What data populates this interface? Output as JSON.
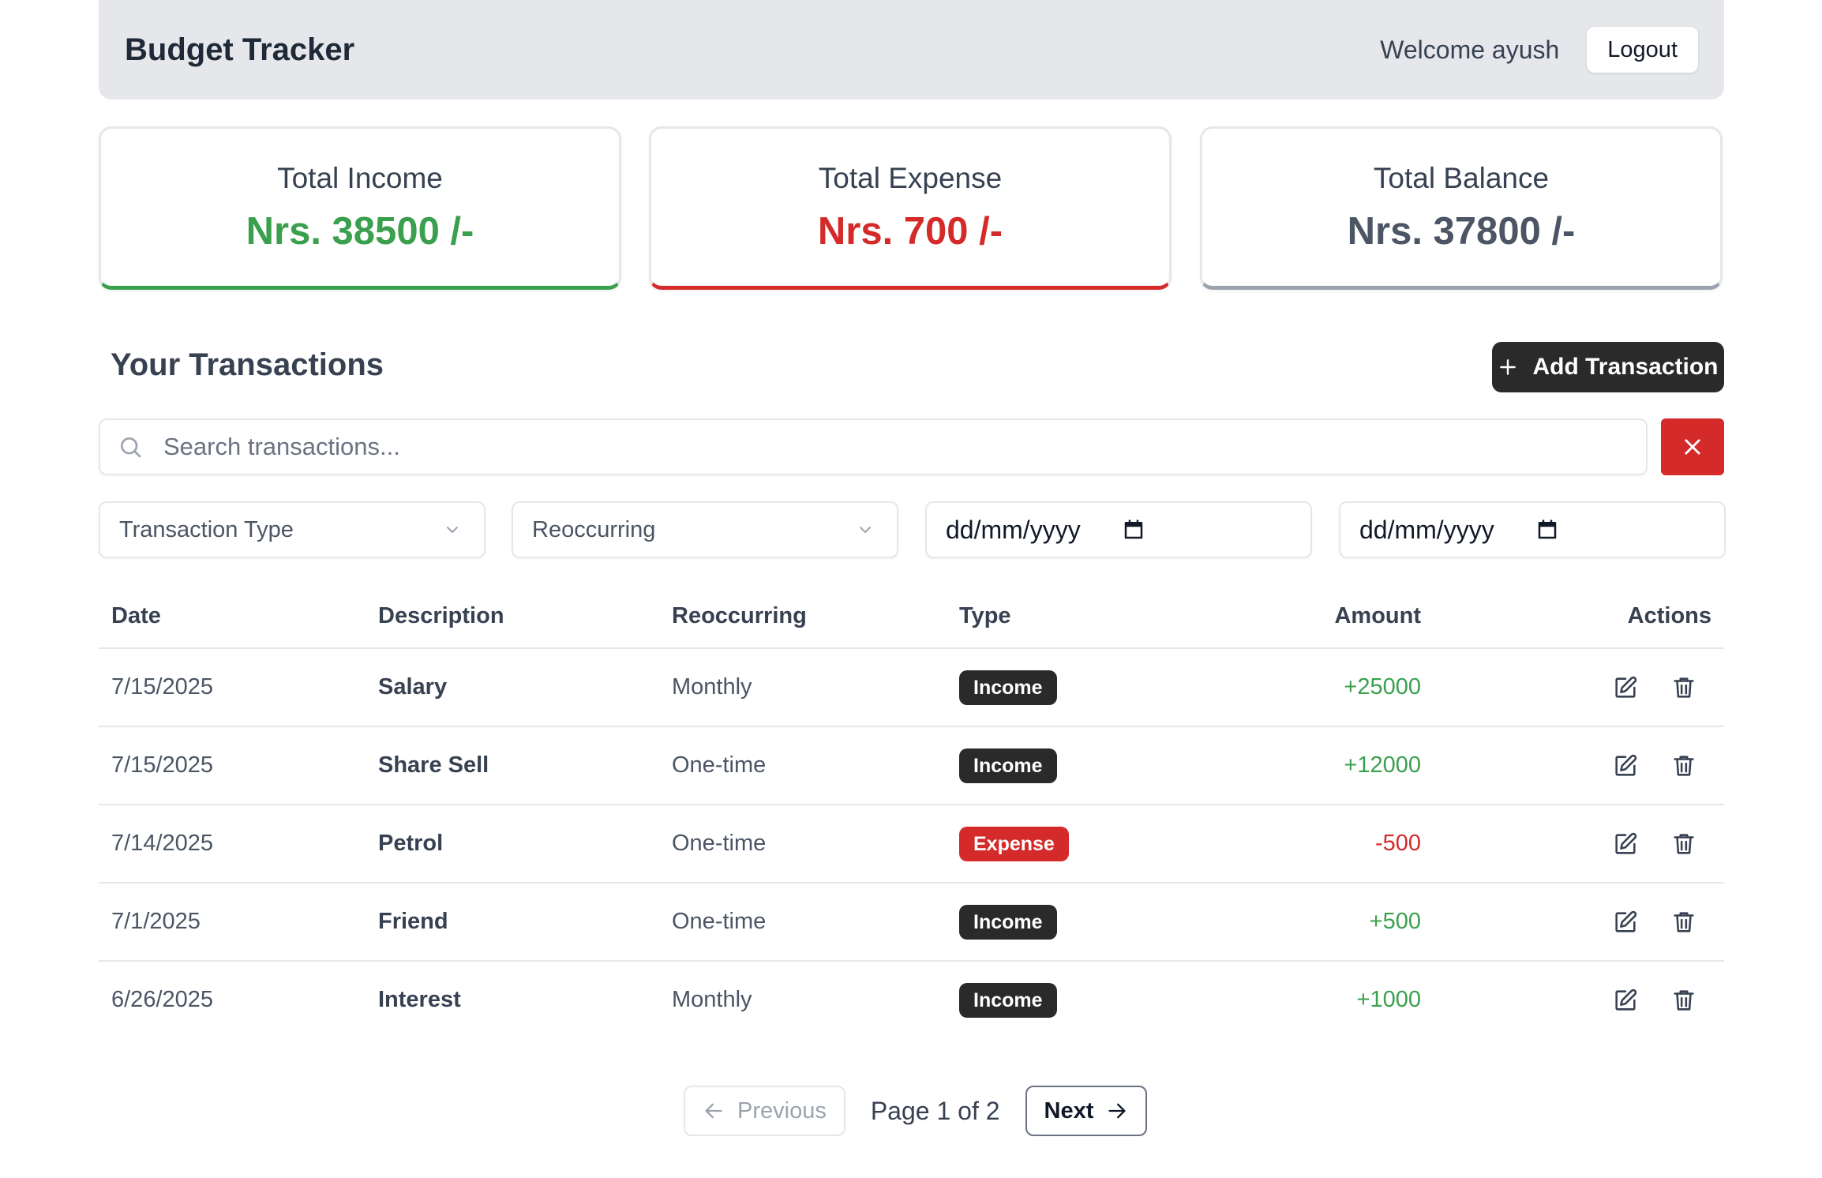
{
  "header": {
    "title": "Budget Tracker",
    "welcome": "Welcome ayush",
    "logout_label": "Logout"
  },
  "stats": {
    "income": {
      "label": "Total Income",
      "value": "Nrs. 38500 /-"
    },
    "expense": {
      "label": "Total Expense",
      "value": "Nrs. 700 /-"
    },
    "balance": {
      "label": "Total Balance",
      "value": "Nrs. 37800 /-"
    }
  },
  "transactions": {
    "title": "Your Transactions",
    "add_label": "Add Transaction",
    "search_placeholder": "Search transactions...",
    "filters": {
      "type": "Transaction Type",
      "recurring": "Reoccurring",
      "date_from": "dd/mm/yyyy",
      "date_to": "dd/mm/yyyy"
    },
    "columns": [
      "Date",
      "Description",
      "Reoccurring",
      "Type",
      "Amount",
      "Actions"
    ],
    "rows": [
      {
        "date": "7/15/2025",
        "description": "Salary",
        "recurring": "Monthly",
        "type": "Income",
        "amount": "+25000"
      },
      {
        "date": "7/15/2025",
        "description": "Share Sell",
        "recurring": "One-time",
        "type": "Income",
        "amount": "+12000"
      },
      {
        "date": "7/14/2025",
        "description": "Petrol",
        "recurring": "One-time",
        "type": "Expense",
        "amount": "-500"
      },
      {
        "date": "7/1/2025",
        "description": "Friend",
        "recurring": "One-time",
        "type": "Income",
        "amount": "+500"
      },
      {
        "date": "6/26/2025",
        "description": "Interest",
        "recurring": "Monthly",
        "type": "Income",
        "amount": "+1000"
      }
    ]
  },
  "pagination": {
    "previous_label": "Previous",
    "page_info": "Page 1 of 2",
    "next_label": "Next"
  },
  "colors": {
    "income": "#3aa04d",
    "expense": "#d42a2a",
    "balance": "#4b5563",
    "dark": "#2a2a2a"
  },
  "icons": {
    "add": "plus-icon",
    "search": "search-icon",
    "clear": "close-icon",
    "dropdown": "chevron-down-icon",
    "date": "calendar-icon",
    "edit": "edit-icon",
    "delete": "trash-icon",
    "prev": "arrow-left-icon",
    "next": "arrow-right-icon"
  }
}
